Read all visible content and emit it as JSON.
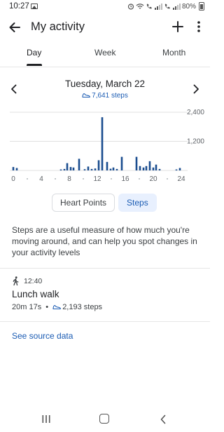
{
  "status_bar": {
    "time": "10:27",
    "battery": "80%"
  },
  "app_bar": {
    "title": "My activity"
  },
  "tabs": [
    {
      "label": "Day",
      "selected": true
    },
    {
      "label": "Week",
      "selected": false
    },
    {
      "label": "Month",
      "selected": false
    }
  ],
  "date_nav": {
    "date": "Tuesday, March 22",
    "steps": "7,641 steps"
  },
  "chart_data": {
    "type": "bar",
    "x_tick_labels": [
      "0",
      "4",
      "8",
      "12",
      "16",
      "20",
      "24"
    ],
    "y_tick_labels": [
      "2,400",
      "1,200"
    ],
    "ylim": [
      0,
      2400
    ],
    "xlim": [
      0,
      24
    ],
    "bar_color": "#1a4d8f",
    "x": [
      0,
      0.5,
      6.8,
      7.3,
      7.7,
      8.2,
      8.6,
      9.4,
      10.2,
      10.7,
      11.2,
      11.7,
      12.2,
      12.7,
      13.4,
      13.9,
      14.3,
      14.8,
      15.5,
      17.6,
      18.1,
      18.6,
      19.0,
      19.5,
      20.0,
      20.4,
      20.9,
      23.3,
      23.8
    ],
    "values": [
      140,
      100,
      40,
      60,
      300,
      140,
      120,
      480,
      50,
      160,
      60,
      80,
      420,
      2193,
      350,
      70,
      120,
      60,
      560,
      560,
      180,
      120,
      180,
      380,
      120,
      240,
      60,
      40,
      100
    ]
  },
  "chips": {
    "heart_points": "Heart Points",
    "steps": "Steps"
  },
  "description": "Steps are a useful measure of how much you're moving around, and can help you spot changes in your activity levels",
  "activity": {
    "time": "12:40",
    "title": "Lunch walk",
    "duration": "20m 17s",
    "separator": "•",
    "steps": "2,193 steps"
  },
  "link": {
    "label": "See source data"
  },
  "colors": {
    "accent": "#1a5bb3",
    "chip_selected_bg": "#e8f0fe",
    "bar": "#1a4d8f"
  },
  "icons": {
    "back": "arrow-back-icon",
    "add": "add-icon",
    "more": "more-vert-icon",
    "prev": "chevron-left-icon",
    "next": "chevron-right-icon",
    "steps": "shoe-icon",
    "walk": "walking-person-icon"
  }
}
